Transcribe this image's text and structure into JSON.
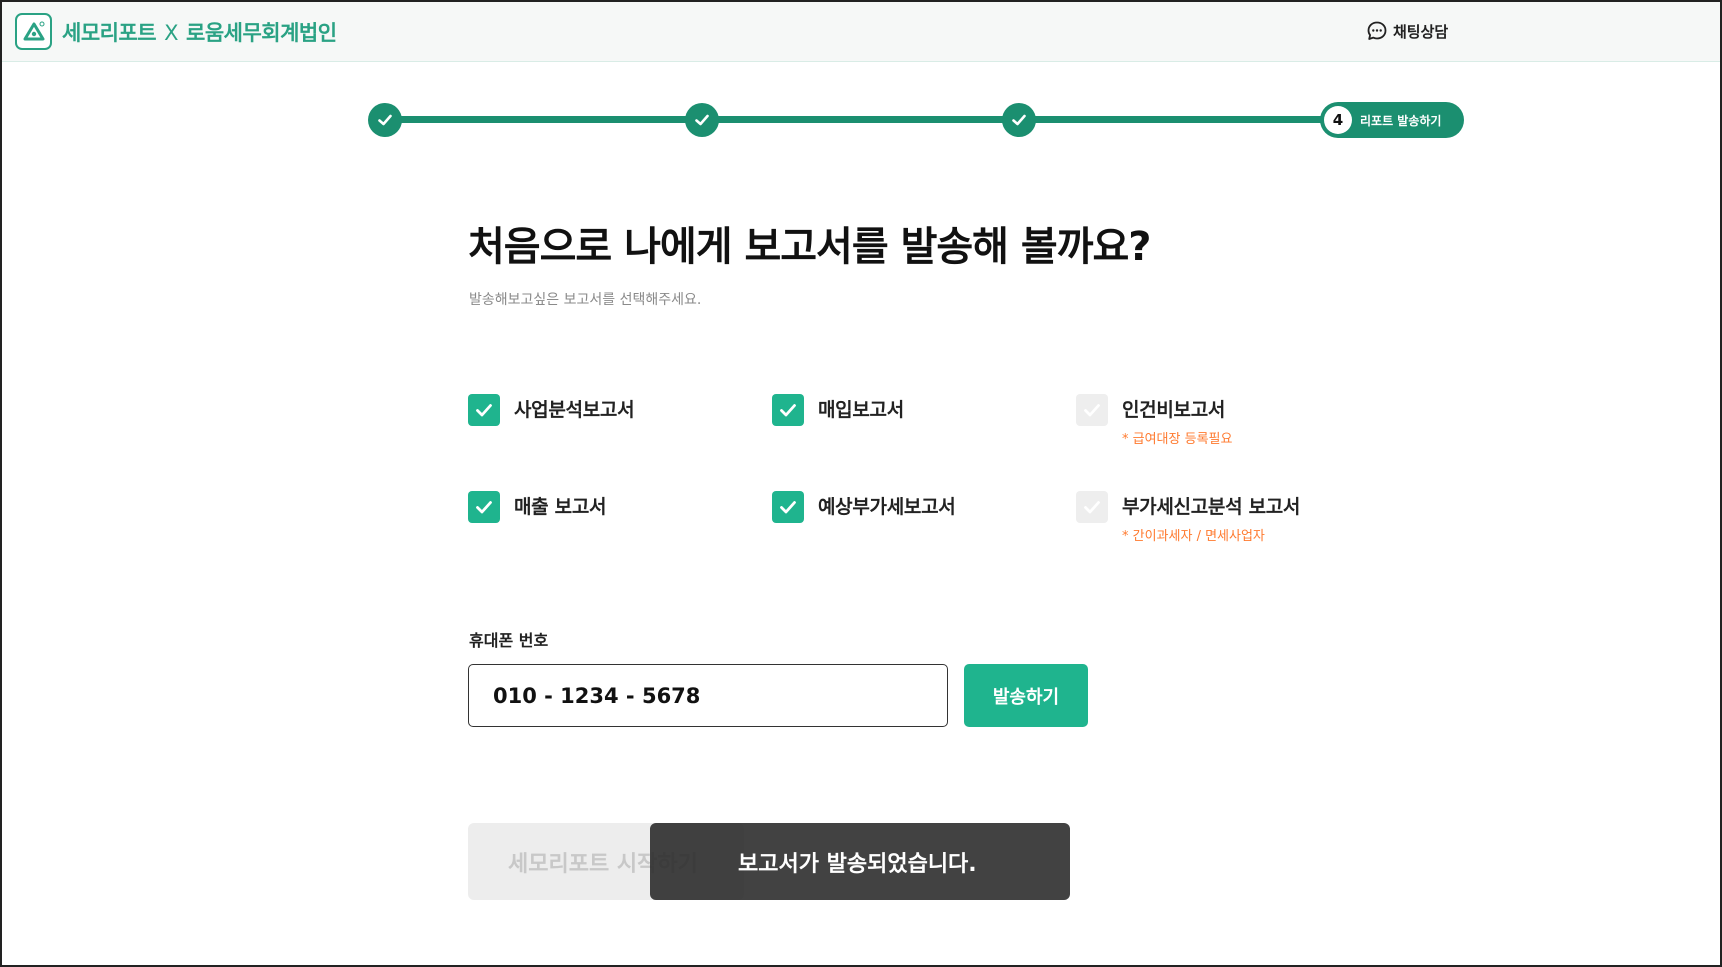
{
  "header": {
    "brand_left": "세모리포트",
    "brand_x": "X",
    "brand_right": "로움세무회계법인",
    "chat_label": "채팅상담"
  },
  "stepper": {
    "active_step_number": "4",
    "active_step_label": "리포트 발송하기"
  },
  "main": {
    "title": "처음으로 나에게 보고서를 발송해 볼까요?",
    "subtitle": "발송해보고싶은 보고서를 선택해주세요."
  },
  "reports": [
    {
      "label": "사업분석보고서",
      "checked": true,
      "note": ""
    },
    {
      "label": "매입보고서",
      "checked": true,
      "note": ""
    },
    {
      "label": "인건비보고서",
      "checked": false,
      "note": "* 급여대장 등록필요"
    },
    {
      "label": "매출 보고서",
      "checked": true,
      "note": ""
    },
    {
      "label": "예상부가세보고서",
      "checked": true,
      "note": ""
    },
    {
      "label": "부가세신고분석 보고서",
      "checked": false,
      "note": "* 간이과세자 / 면세사업자"
    }
  ],
  "phone": {
    "label": "휴대폰 번호",
    "value": "010 - 1234 - 5678",
    "send_label": "발송하기"
  },
  "start_button_label": "세모리포트 시작하기",
  "toast_message": "보고서가 발송되었습니다.",
  "colors": {
    "brand": "#2aa284",
    "accent": "#1fb48e",
    "note": "#ff7a2f"
  }
}
